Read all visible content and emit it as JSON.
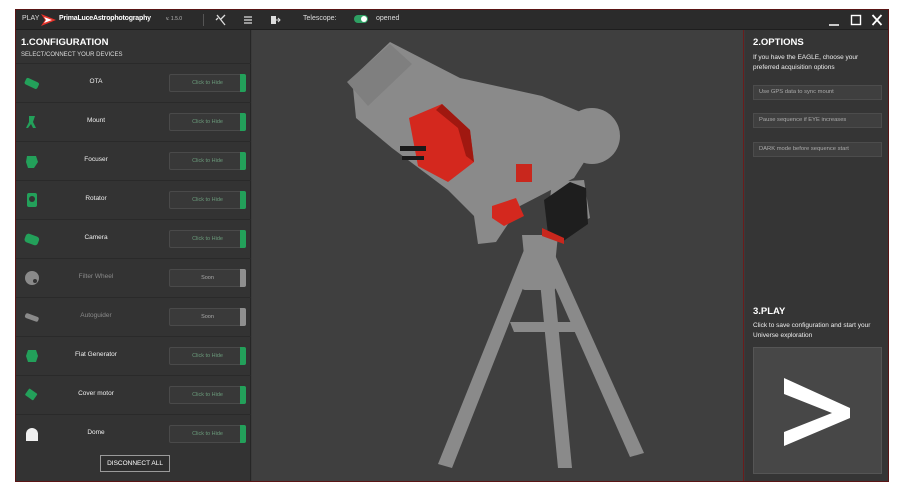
{
  "titlebar": {
    "play_label": "PLAY",
    "brand": "PrimaLuceAstrophotography",
    "version": "v. 1.5.0",
    "telescope_label": "Telescope:",
    "telescope_state": "opened",
    "icons": [
      "tools-icon",
      "menu-icon",
      "export-icon"
    ],
    "window_controls": [
      "minimize",
      "maximize",
      "close"
    ]
  },
  "configuration": {
    "title": "1.CONFIGURATION",
    "subtitle": "SELECT/CONNECT YOUR DEVICES",
    "devices": [
      {
        "name": "OTA",
        "button": "Click to Hide",
        "enabled": true,
        "icon": "ota-icon"
      },
      {
        "name": "Mount",
        "button": "Click to Hide",
        "enabled": true,
        "icon": "mount-icon"
      },
      {
        "name": "Focuser",
        "button": "Click to Hide",
        "enabled": true,
        "icon": "focuser-icon"
      },
      {
        "name": "Rotator",
        "button": "Click to Hide",
        "enabled": true,
        "icon": "rotator-icon"
      },
      {
        "name": "Camera",
        "button": "Click to Hide",
        "enabled": true,
        "icon": "camera-icon"
      },
      {
        "name": "Filter Wheel",
        "button": "Soon",
        "enabled": false,
        "icon": "filter-wheel-icon"
      },
      {
        "name": "Autoguider",
        "button": "Soon",
        "enabled": false,
        "icon": "autoguider-icon"
      },
      {
        "name": "Flat Generator",
        "button": "Click to Hide",
        "enabled": true,
        "icon": "flat-generator-icon"
      },
      {
        "name": "Cover motor",
        "button": "Click to Hide",
        "enabled": true,
        "icon": "cover-motor-icon"
      },
      {
        "name": "Dome",
        "button": "Click to Hide",
        "enabled": true,
        "icon": "dome-icon"
      }
    ],
    "disconnect_label": "DISCONNECT ALL"
  },
  "options": {
    "title": "2.OPTIONS",
    "description": "If you have the EAGLE, choose your preferred acquisition options",
    "buttons": [
      "Use GPS data to sync mount",
      "Pause sequence if EYE increases",
      "DARK mode before sequence start"
    ]
  },
  "play": {
    "title": "3.PLAY",
    "description": "Click to save configuration and start your Universe exploration",
    "button_icon": "chevron-right-icon"
  },
  "colors": {
    "accent_green": "#23a05a",
    "brand_red": "#e8332a",
    "telescope_grey": "#8a8a8a"
  }
}
